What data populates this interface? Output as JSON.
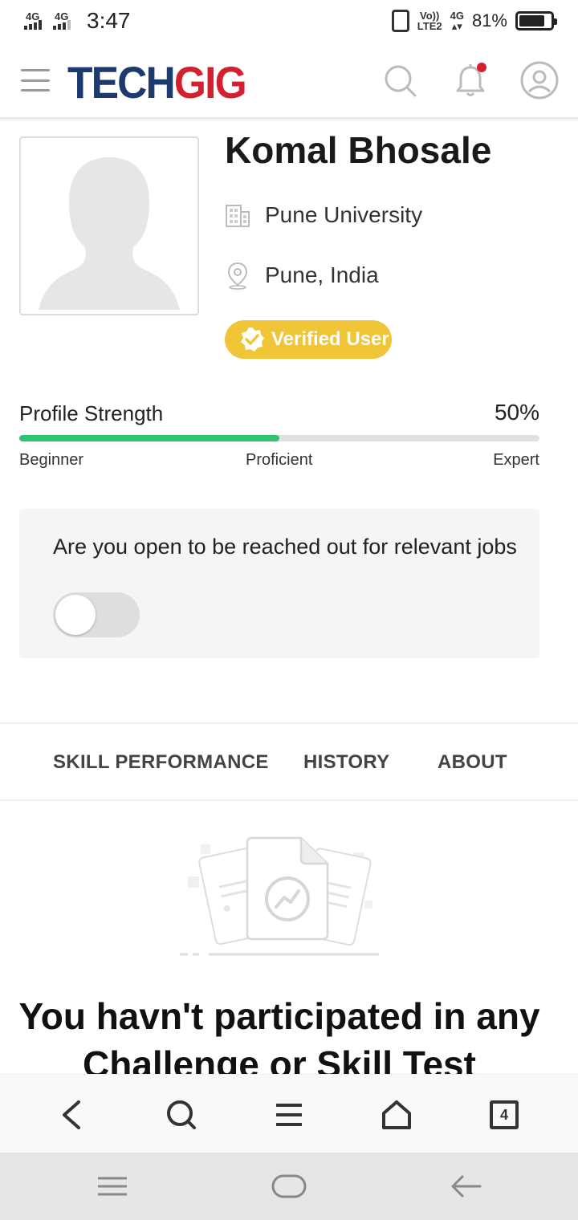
{
  "status_bar": {
    "signal1_label": "4G",
    "signal2_label": "4G",
    "time": "3:47",
    "volte_top": "Vo))",
    "volte_bottom": "LTE2",
    "net_label": "4G",
    "battery_percent": "81%",
    "battery_level": 0.81
  },
  "header": {
    "logo_part1": "TECH",
    "logo_part2": "GIG",
    "icons": [
      "menu-icon",
      "search-icon",
      "bell-icon",
      "user-icon"
    ],
    "notification_dot_color": "#d3202f"
  },
  "profile": {
    "name": "Komal Bhosale",
    "organization": "Pune University",
    "location": "Pune, India",
    "verified_label": "Verified User"
  },
  "strength": {
    "label": "Profile Strength",
    "value": "50%",
    "fraction": 0.5,
    "levels": [
      "Beginner",
      "Proficient",
      "Expert"
    ],
    "fill_color": "#2ec46d"
  },
  "job_card": {
    "question": "Are you open to be reached out for relevant jobs",
    "toggle_on": false
  },
  "tabs": [
    {
      "label": "SKILL PERFORMANCE"
    },
    {
      "label": "HISTORY"
    },
    {
      "label": "ABOUT"
    }
  ],
  "empty_state": {
    "line1": "You havn't participated in any",
    "line2": "Challenge or Skill Test"
  },
  "browser_nav": {
    "tab_count": "4",
    "icons": [
      "back-icon",
      "search-icon",
      "menu-icon",
      "home-icon",
      "tabs-icon"
    ]
  },
  "system_nav": {
    "icons": [
      "recents-icon",
      "home-icon",
      "back-icon"
    ]
  }
}
